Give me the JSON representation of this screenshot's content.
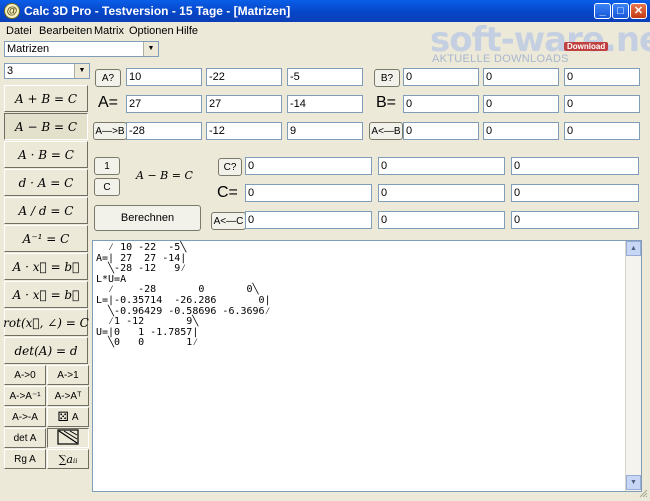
{
  "window": {
    "title": "Calc 3D Pro - Testversion - 15 Tage - [Matrizen]",
    "app_icon": "@"
  },
  "watermark": {
    "brand": "soft-ware.net",
    "badge": "Download",
    "tagline": "AKTUELLE DOWNLOADS"
  },
  "menu": [
    "Datei",
    "Bearbeiten",
    "Matrix",
    "Optionen",
    "Hilfe"
  ],
  "mode_select": "Matrizen",
  "size_select": "3",
  "left_buttons": [
    "A + B = C",
    "A − B = C",
    "A · B = C",
    "d · A = C",
    "A / d = C",
    "A⁻¹ = C",
    "A · x⃗ = b⃗",
    "A · x⃗ = b⃗",
    "rot(x⃗, ∠) = C",
    "det(A) = d"
  ],
  "small_buttons": [
    "A->0",
    "A->1",
    "A->A⁻¹",
    "A->Aᵀ",
    "A->-A",
    "A",
    "det A",
    "",
    "Rg A",
    "∑aᵢᵢ"
  ],
  "matrix_a": {
    "button": "A?",
    "label": "A=",
    "copy_button": "A—>B",
    "rows": [
      [
        "10",
        "-22",
        "-5"
      ],
      [
        "27",
        "27",
        "-14"
      ],
      [
        "-28",
        "-12",
        "9"
      ]
    ]
  },
  "matrix_b": {
    "button": "B?",
    "label": "B=",
    "copy_button": "A<—B",
    "rows": [
      [
        "0",
        "0",
        "0"
      ],
      [
        "0",
        "0",
        "0"
      ],
      [
        "0",
        "0",
        "0"
      ]
    ]
  },
  "matrix_c": {
    "button": "C?",
    "label": "C=",
    "copy_button": "A<—C",
    "rows": [
      [
        "0",
        "0",
        "0"
      ],
      [
        "0",
        "0",
        "0"
      ],
      [
        "0",
        "0",
        "0"
      ]
    ]
  },
  "mode_buttons": [
    "1",
    "C"
  ],
  "operation": "A − B = C",
  "calculate_button": "Berechnen",
  "output_text": "  ⁄ 10 -22  -5╲\nA=| 27  27 -14|\n  ╲-28 -12   9⁄\nL*U=A\n  ⁄    -28       0       0╲\nL=|-0.35714  -26.286       0|\n  ╲-0.96429 -0.58696 -6.3696⁄\n  ⁄1 -12       9╲\nU=|0   1 -1.7857|\n  ╲0   0       1⁄",
  "colors": {
    "titlebar": "#0646c8",
    "face": "#ece9d8",
    "field_border": "#7f9db9"
  }
}
